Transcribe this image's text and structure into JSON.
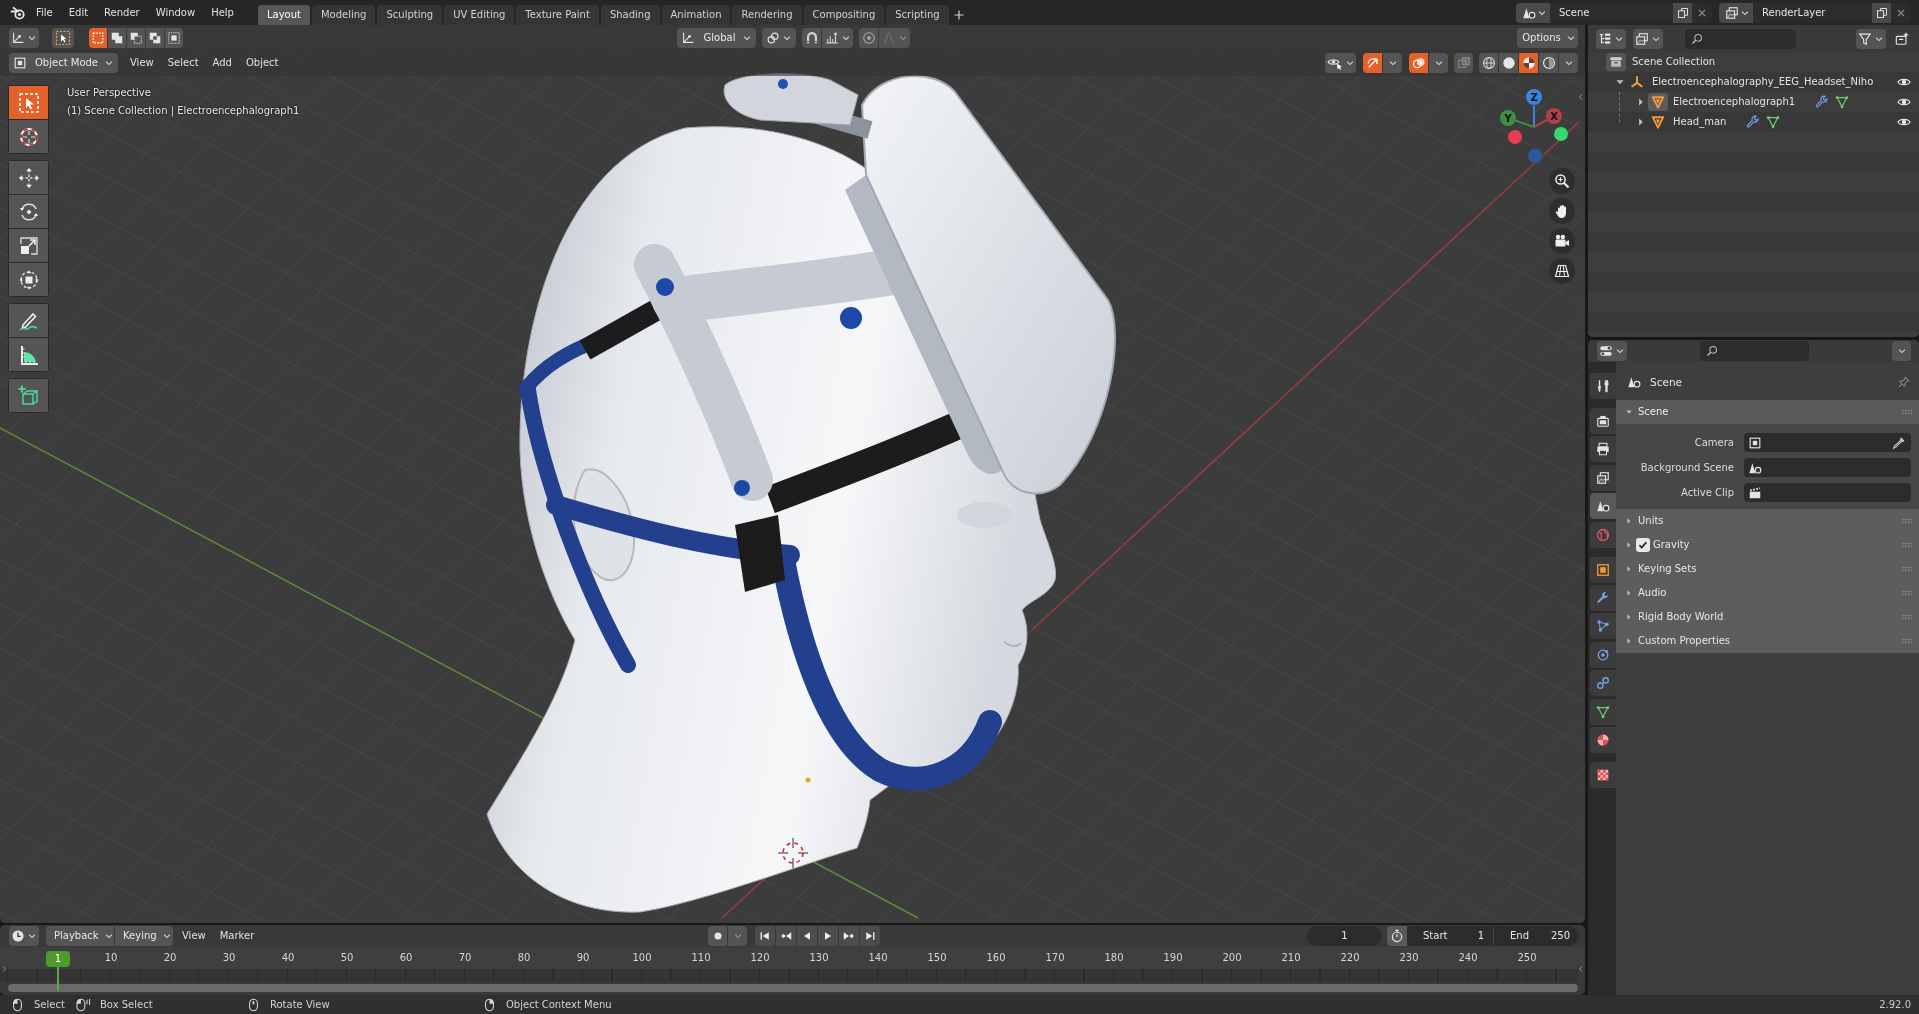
{
  "topbar": {
    "menu": [
      "File",
      "Edit",
      "Render",
      "Window",
      "Help"
    ],
    "workspaces": [
      {
        "label": "Layout",
        "selected": true
      },
      {
        "label": "Modeling",
        "selected": false
      },
      {
        "label": "Sculpting",
        "selected": false
      },
      {
        "label": "UV Editing",
        "selected": false
      },
      {
        "label": "Texture Paint",
        "selected": false
      },
      {
        "label": "Shading",
        "selected": false
      },
      {
        "label": "Animation",
        "selected": false
      },
      {
        "label": "Rendering",
        "selected": false
      },
      {
        "label": "Compositing",
        "selected": false
      },
      {
        "label": "Scripting",
        "selected": false
      }
    ],
    "scene": "Scene",
    "view_layer": "RenderLayer"
  },
  "tool_settings": {
    "selection_modes": [
      {
        "kind": "set",
        "selected": true
      },
      {
        "kind": "extend",
        "selected": false
      },
      {
        "kind": "subtract",
        "selected": false
      },
      {
        "kind": "invert",
        "selected": false
      },
      {
        "kind": "intersect",
        "selected": false
      }
    ],
    "orientation": "Global",
    "snap": {
      "on": false
    },
    "proportional_editing": {
      "on": false
    },
    "options": "Options"
  },
  "viewport": {
    "mode": "Object Mode",
    "menu": [
      "View",
      "Select",
      "Add",
      "Object"
    ],
    "show_gizmos": {
      "on": true
    },
    "show_overlays": {
      "on": true
    },
    "xray": {
      "on": false
    },
    "shading": [
      {
        "kind": "wireframe",
        "selected": false
      },
      {
        "kind": "solid",
        "selected": false
      },
      {
        "kind": "material",
        "selected": true
      },
      {
        "kind": "rendered",
        "selected": false
      }
    ],
    "info": [
      "User Perspective",
      "(1) Scene Collection | Electroencephalograph1"
    ],
    "tool_groups": [
      {
        "tools": [
          {
            "kind": "select_box",
            "selected": true
          },
          {
            "kind": "cursor",
            "selected": false
          }
        ]
      },
      {
        "tools": [
          {
            "kind": "move",
            "selected": false
          },
          {
            "kind": "rotate",
            "selected": false
          },
          {
            "kind": "scale",
            "selected": false
          },
          {
            "kind": "transform",
            "selected": false
          }
        ]
      },
      {
        "tools": [
          {
            "kind": "annotate",
            "selected": false
          },
          {
            "kind": "measure",
            "selected": false
          }
        ]
      },
      {
        "tools": [
          {
            "kind": "add_cube",
            "selected": false
          }
        ]
      }
    ],
    "axes": [
      {
        "label": "X",
        "color": "#b4404e"
      },
      {
        "label": "Y",
        "color": "#3e8e48"
      },
      {
        "label": "Z",
        "color": "#3b84de"
      }
    ],
    "navigation": [
      {
        "kind": "zoom"
      },
      {
        "kind": "pan"
      },
      {
        "kind": "camera"
      },
      {
        "kind": "perspective"
      }
    ]
  },
  "outliner": {
    "root": "Scene Collection",
    "items": [
      {
        "label": "Electroencephalography_EEG_Headset_Niho",
        "kind": "empty",
        "expanded": true,
        "visible": true,
        "active": false,
        "children": [
          {
            "label": "Electroencephalograph1",
            "kind": "mesh",
            "expanded": false,
            "visible": true,
            "active": true
          },
          {
            "label": "Head_man",
            "kind": "mesh",
            "expanded": false,
            "visible": true,
            "active": false
          }
        ]
      }
    ]
  },
  "properties": {
    "tab_groups": [
      {
        "tabs": [
          {
            "kind": "tool",
            "selected": false
          }
        ]
      },
      {
        "tabs": [
          {
            "kind": "render",
            "selected": false
          },
          {
            "kind": "output",
            "selected": false
          },
          {
            "kind": "view_layer",
            "selected": false
          },
          {
            "kind": "scene",
            "selected": true
          },
          {
            "kind": "world",
            "selected": false
          }
        ]
      },
      {
        "tabs": [
          {
            "kind": "object",
            "selected": false
          },
          {
            "kind": "modifiers",
            "selected": false
          },
          {
            "kind": "particles",
            "selected": false
          },
          {
            "kind": "physics",
            "selected": false
          },
          {
            "kind": "constraints",
            "selected": false
          },
          {
            "kind": "data",
            "selected": false
          },
          {
            "kind": "material",
            "selected": false
          }
        ]
      },
      {
        "tabs": [
          {
            "kind": "texture",
            "selected": false
          }
        ]
      }
    ],
    "context": "Scene",
    "panel": {
      "title": "Scene",
      "expanded": true,
      "fields": [
        {
          "label": "Camera",
          "kind": "camera"
        },
        {
          "label": "Background Scene",
          "kind": "scene"
        },
        {
          "label": "Active Clip",
          "kind": "clip"
        }
      ],
      "subpanels": [
        {
          "title": "Units",
          "kind": "plain",
          "expanded": false
        },
        {
          "title": "Gravity",
          "kind": "toggle",
          "checked": true,
          "expanded": false
        },
        {
          "title": "Keying Sets",
          "kind": "plain",
          "expanded": false
        },
        {
          "title": "Audio",
          "kind": "plain",
          "expanded": false
        },
        {
          "title": "Rigid Body World",
          "kind": "plain",
          "expanded": false
        },
        {
          "title": "Custom Properties",
          "kind": "plain",
          "expanded": false
        }
      ]
    }
  },
  "timeline": {
    "menus": [
      {
        "label": "Playback",
        "kind": "dropdown"
      },
      {
        "label": "Keying",
        "kind": "dropdown"
      },
      {
        "label": "View",
        "kind": "menu"
      },
      {
        "label": "Marker",
        "kind": "menu"
      }
    ],
    "auto_keying": {
      "on": false
    },
    "current_frame": "1",
    "start": {
      "label": "Start",
      "value": "1"
    },
    "end": {
      "label": "End",
      "value": "250"
    },
    "playhead": "1",
    "ruler": [
      "10",
      "20",
      "30",
      "40",
      "50",
      "60",
      "70",
      "80",
      "90",
      "100",
      "110",
      "120",
      "130",
      "140",
      "150",
      "160",
      "170",
      "180",
      "190",
      "200",
      "210",
      "220",
      "230",
      "240",
      "250"
    ]
  },
  "status_bar": {
    "hints": [
      {
        "label": "Select",
        "kind": "left_click"
      },
      {
        "label": "Box Select",
        "kind": "left_drag"
      },
      {
        "label": "Rotate View",
        "kind": "middle_drag"
      },
      {
        "label": "Object Context Menu",
        "kind": "right_click"
      }
    ],
    "version": "2.92.0"
  }
}
